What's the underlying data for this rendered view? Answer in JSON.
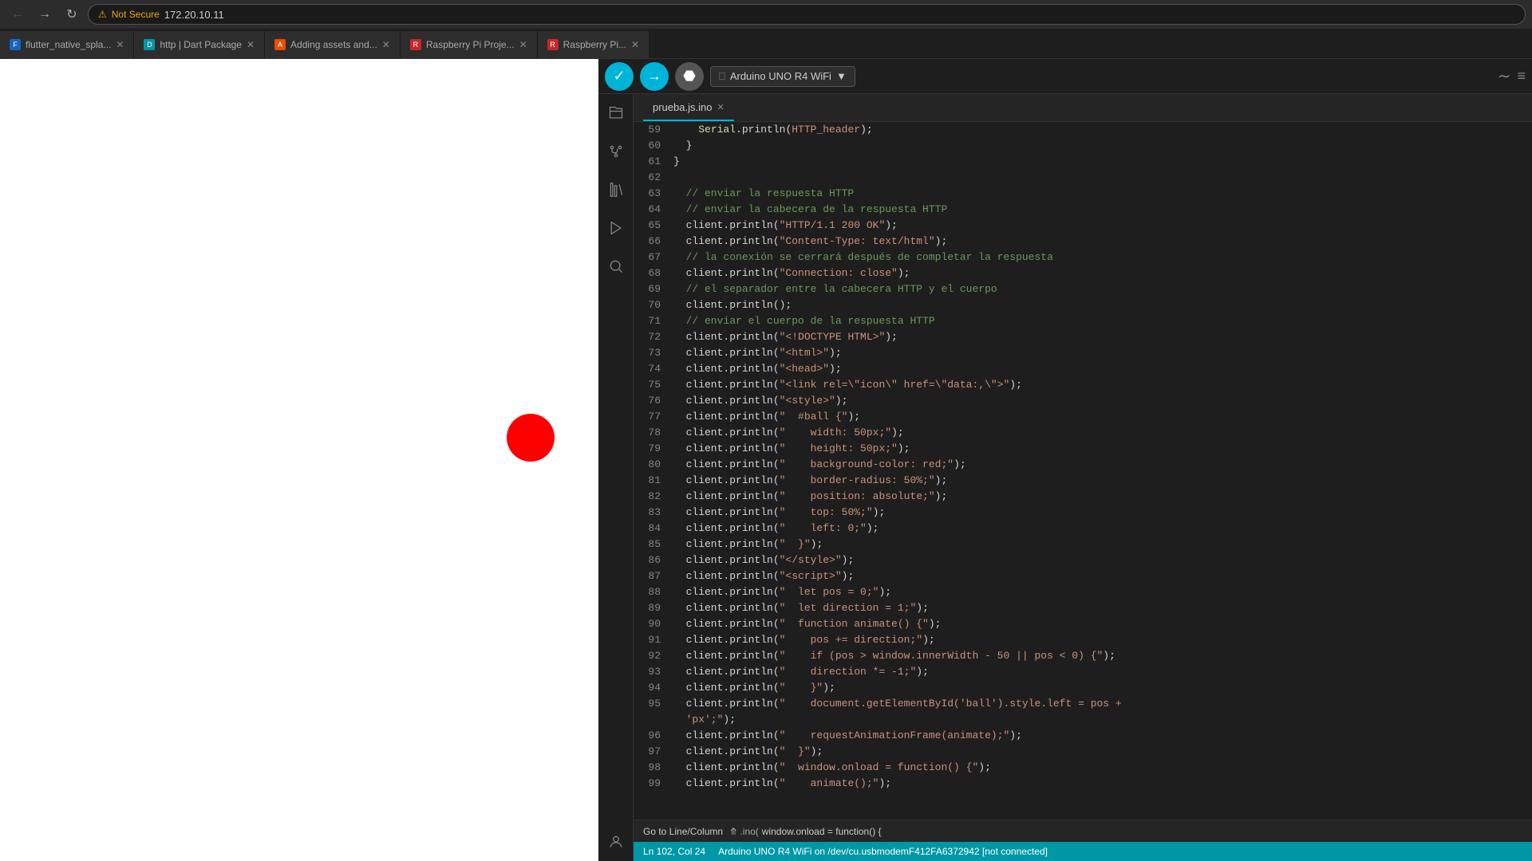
{
  "browser": {
    "nav": {
      "back_label": "←",
      "forward_label": "→",
      "refresh_label": "↻"
    },
    "address": {
      "warning": "⚠",
      "not_secure": "Not Secure",
      "url": "172.20.10.11"
    },
    "tabs": [
      {
        "id": "tab1",
        "favicon_color": "#1565c0",
        "favicon_char": "F",
        "title": "flutter_native_spla...",
        "active": false
      },
      {
        "id": "tab2",
        "favicon_color": "#0097a7",
        "favicon_char": "D",
        "title": "http | Dart Package",
        "active": false
      },
      {
        "id": "tab3",
        "favicon_color": "#e65100",
        "favicon_char": "A",
        "title": "Adding assets and...",
        "active": false
      },
      {
        "id": "tab4",
        "favicon_color": "#c62828",
        "favicon_char": "R",
        "title": "Raspberry Pi Proje...",
        "active": false
      },
      {
        "id": "tab5",
        "favicon_color": "#c62828",
        "favicon_char": "R",
        "title": "Raspberry Pi...",
        "active": false
      }
    ]
  },
  "arduino": {
    "toolbar": {
      "verify_title": "✓",
      "upload_title": "→",
      "debug_title": "⬡",
      "board_label": "Arduino UNO R4 WiFi",
      "serial_icon": "〜",
      "menu_icon": "≡"
    },
    "filename": "prueba.js.ino",
    "sidebar_icons": [
      {
        "id": "files",
        "symbol": "🗂",
        "name": "files-icon"
      },
      {
        "id": "source-control",
        "symbol": "⎇",
        "name": "source-control-icon"
      },
      {
        "id": "library",
        "symbol": "📚",
        "name": "library-icon"
      },
      {
        "id": "debug",
        "symbol": "▷",
        "name": "debug-icon"
      },
      {
        "id": "search",
        "symbol": "🔍",
        "name": "search-icon"
      },
      {
        "id": "account",
        "symbol": "👤",
        "name": "account-icon"
      }
    ],
    "code_lines": [
      {
        "num": 59,
        "content": "    Serial.println(HTTP_header);",
        "type": "mixed"
      },
      {
        "num": 60,
        "content": "  }",
        "type": "plain"
      },
      {
        "num": 61,
        "content": "}",
        "type": "plain"
      },
      {
        "num": 62,
        "content": "",
        "type": "plain"
      },
      {
        "num": 63,
        "content": "  // enviar la respuesta HTTP",
        "type": "comment"
      },
      {
        "num": 64,
        "content": "  // enviar la cabecera de la respuesta HTTP",
        "type": "comment"
      },
      {
        "num": 65,
        "content": "  client.println(\"HTTP/1.1 200 OK\");",
        "type": "mixed"
      },
      {
        "num": 66,
        "content": "  client.println(\"Content-Type: text/html\");",
        "type": "mixed"
      },
      {
        "num": 67,
        "content": "  // la conexión se cerrará después de completar la respuesta",
        "type": "comment"
      },
      {
        "num": 68,
        "content": "  client.println(\"Connection: close\");",
        "type": "mixed"
      },
      {
        "num": 69,
        "content": "  // el separador entre la cabecera HTTP y el cuerpo",
        "type": "comment"
      },
      {
        "num": 70,
        "content": "  client.println();",
        "type": "mixed"
      },
      {
        "num": 71,
        "content": "  // enviar el cuerpo de la respuesta HTTP",
        "type": "comment"
      },
      {
        "num": 72,
        "content": "  client.println(\"<!DOCTYPE HTML>\");",
        "type": "mixed"
      },
      {
        "num": 73,
        "content": "  client.println(\"<html>\");",
        "type": "mixed"
      },
      {
        "num": 74,
        "content": "  client.println(\"<head>\");",
        "type": "mixed"
      },
      {
        "num": 75,
        "content": "  client.println(\"<link rel=\\\"icon\\\" href=\\\"data:,\\\">\");",
        "type": "mixed"
      },
      {
        "num": 76,
        "content": "  client.println(\"<style>\");",
        "type": "mixed"
      },
      {
        "num": 77,
        "content": "  client.println(\"  #ball {\");",
        "type": "mixed"
      },
      {
        "num": 78,
        "content": "  client.println(\"    width: 50px;\");",
        "type": "mixed"
      },
      {
        "num": 79,
        "content": "  client.println(\"    height: 50px;\");",
        "type": "mixed"
      },
      {
        "num": 80,
        "content": "  client.println(\"    background-color: red;\");",
        "type": "mixed"
      },
      {
        "num": 81,
        "content": "  client.println(\"    border-radius: 50%;\");",
        "type": "mixed"
      },
      {
        "num": 82,
        "content": "  client.println(\"    position: absolute;\");",
        "type": "mixed"
      },
      {
        "num": 83,
        "content": "  client.println(\"    top: 50%;\");",
        "type": "mixed"
      },
      {
        "num": 84,
        "content": "  client.println(\"    left: 0;\");",
        "type": "mixed"
      },
      {
        "num": 85,
        "content": "  client.println(\"  }\");",
        "type": "mixed"
      },
      {
        "num": 86,
        "content": "  client.println(\"</style>\");",
        "type": "mixed"
      },
      {
        "num": 87,
        "content": "  client.println(\"<script>\");",
        "type": "mixed"
      },
      {
        "num": 88,
        "content": "  client.println(\"  let pos = 0;\");",
        "type": "mixed"
      },
      {
        "num": 89,
        "content": "  client.println(\"  let direction = 1;\");",
        "type": "mixed"
      },
      {
        "num": 90,
        "content": "  client.println(\"  function animate() {\");",
        "type": "mixed"
      },
      {
        "num": 91,
        "content": "  client.println(\"    pos += direction;\");",
        "type": "mixed"
      },
      {
        "num": 92,
        "content": "  client.println(\"    if (pos > window.innerWidth - 50 || pos < 0) {\");",
        "type": "mixed"
      },
      {
        "num": 93,
        "content": "  client.println(\"    direction *= -1;\");",
        "type": "mixed"
      },
      {
        "num": 94,
        "content": "  client.println(\"    }\");",
        "type": "mixed"
      },
      {
        "num": 95,
        "content": "  client.println(\"    document.getElementById('ball').style.left = pos +",
        "type": "mixed"
      },
      {
        "num": 95,
        "content": "'px';\");",
        "type": "mixed2"
      },
      {
        "num": 96,
        "content": "  client.println(\"    requestAnimationFrame(animate);\");",
        "type": "mixed"
      },
      {
        "num": 97,
        "content": "  client.println(\"  }\");",
        "type": "mixed"
      },
      {
        "num": 98,
        "content": "  client.println(\"  window.onload = function() {\");",
        "type": "mixed"
      },
      {
        "num": 99,
        "content": "  client.println(\"    animate();\");",
        "type": "mixed"
      }
    ],
    "goto_bar": "Go to Line/Column",
    "status": {
      "line_col": "Ln 102, Col 24",
      "board": "Arduino UNO R4 WiFi on /dev/cu.usbmodemF412FA6372942 [not connected]"
    }
  }
}
